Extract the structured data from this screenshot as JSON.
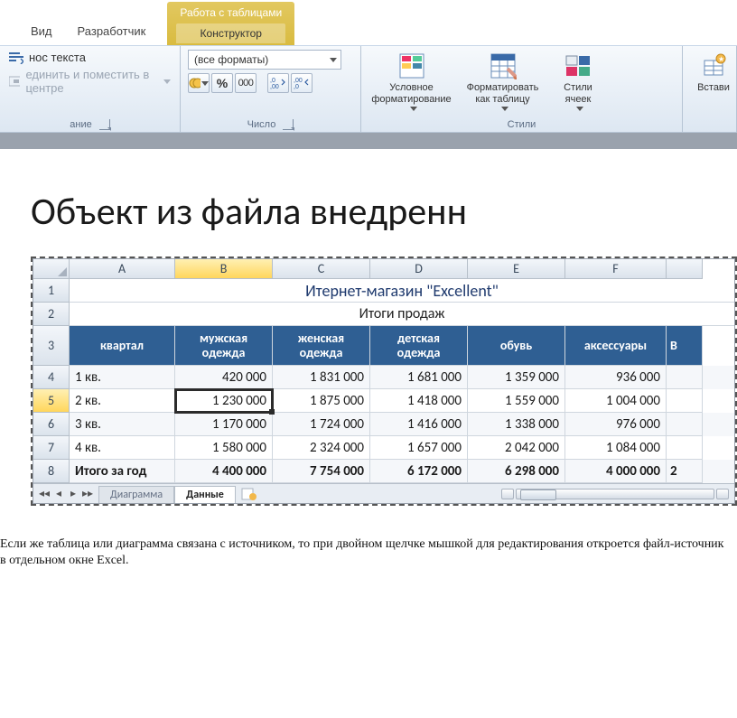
{
  "ribbon": {
    "tabs": {
      "view": "Вид",
      "developer": "Разработчик"
    },
    "context": {
      "group": "Работа с таблицами",
      "tab": "Конструктор"
    },
    "alignment": {
      "wrap": "нос текста",
      "merge": "единить и поместить в центре",
      "label": "ание"
    },
    "number": {
      "format_selected": "(все форматы)",
      "percent": "%",
      "thousands": "000",
      "inc": ",0",
      "dec": ",00",
      "label": "Число"
    },
    "styles": {
      "conditional": "Условное форматирование",
      "format_table": "Форматировать как таблицу",
      "cell_styles": "Стили ячеек",
      "label": "Стили"
    },
    "cells": {
      "insert": "Встави"
    }
  },
  "document": {
    "title": "Объект из файла внедренн"
  },
  "excel": {
    "columns": [
      "A",
      "B",
      "C",
      "D",
      "E",
      "F"
    ],
    "title": "Итернет-магазин \"Excellent\"",
    "subtitle": "Итоги продаж",
    "headers": {
      "quarter": "квартал",
      "men": "мужская одежда",
      "women": "женская одежда",
      "kids": "детская одежда",
      "shoes": "обувь",
      "acc": "аксессуары",
      "extra": "В"
    },
    "rows": [
      {
        "n": "4",
        "q": "1 кв.",
        "v": [
          "420 000",
          "1 831 000",
          "1 681 000",
          "1 359 000",
          "936 000"
        ]
      },
      {
        "n": "5",
        "q": "2 кв.",
        "v": [
          "1 230 000",
          "1 875 000",
          "1 418 000",
          "1 559 000",
          "1 004 000"
        ]
      },
      {
        "n": "6",
        "q": "3 кв.",
        "v": [
          "1 170 000",
          "1 724 000",
          "1 416 000",
          "1 338 000",
          "976 000"
        ]
      },
      {
        "n": "7",
        "q": "4 кв.",
        "v": [
          "1 580 000",
          "2 324 000",
          "1 657 000",
          "2 042 000",
          "1 084 000"
        ]
      }
    ],
    "total": {
      "n": "8",
      "q": "Итого за год",
      "v": [
        "4 400 000",
        "7 754 000",
        "6 172 000",
        "6 298 000",
        "4 000 000",
        "2"
      ]
    },
    "row_nums": {
      "r1": "1",
      "r2": "2",
      "r3": "3"
    },
    "sheets": {
      "chart": "Диаграмма",
      "data": "Данные"
    },
    "selected_cell": "B5"
  },
  "caption": "Если же таблица или диаграмма связана с источником, то при двойном щелчке мышкой для редактирования откроется файл-источник в отдельном окне Excel."
}
